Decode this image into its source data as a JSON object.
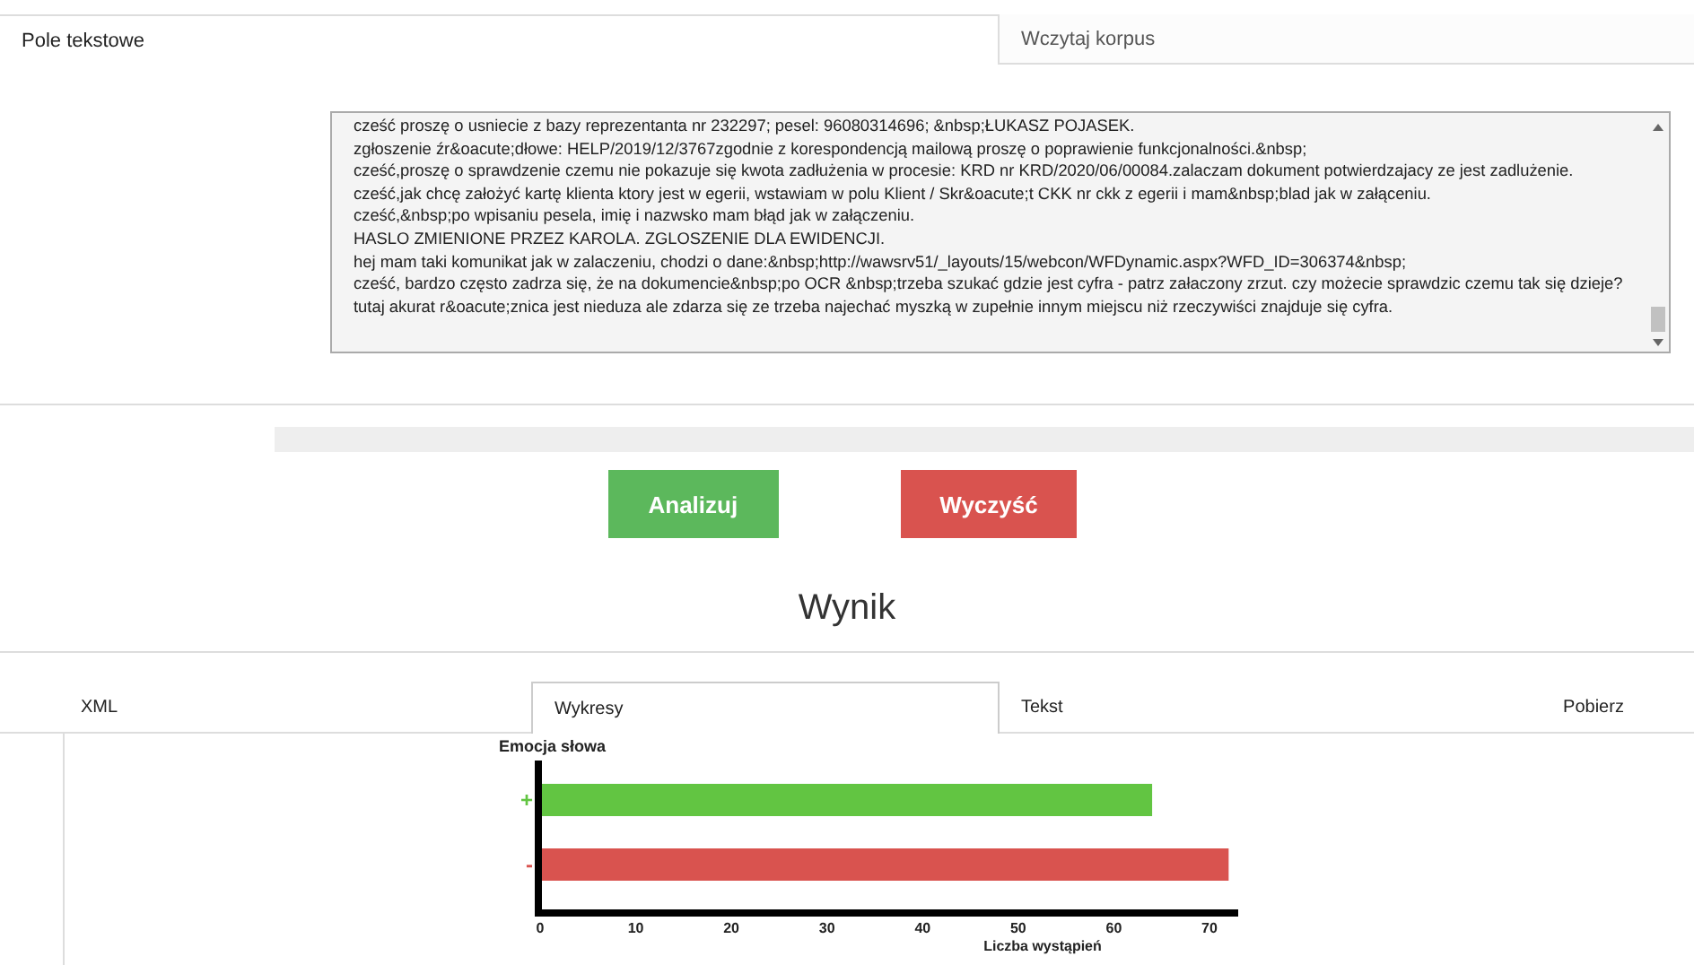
{
  "tabs": [
    {
      "label": "Pole tekstowe",
      "selected": true
    },
    {
      "label": "Wczytaj korpus",
      "selected": false
    }
  ],
  "textarea": {
    "lines": [
      "cześć proszę o usniecie z bazy reprezentanta nr 232297; pesel: 96080314696; &nbsp;ŁUKASZ POJASEK.",
      "zgłoszenie źr&oacute;dłowe: HELP/2019/12/3767zgodnie z korespondencją mailową proszę o poprawienie funkcjonalności.&nbsp;",
      "cześć,proszę o sprawdzenie czemu nie pokazuje się kwota zadłużenia w procesie: KRD nr KRD/2020/06/00084.zalaczam dokument potwierdzajacy ze jest zadlużenie.",
      "cześć,jak chcę założyć kartę klienta ktory jest w egerii, wstawiam w polu Klient / Skr&oacute;t CKK nr ckk z egerii i mam&nbsp;blad jak w załąceniu.",
      "cześć,&nbsp;po wpisaniu pesela, imię i nazwsko mam błąd jak w załączeniu.",
      "HASLO ZMIENIONE PRZEZ KAROLA. ZGLOSZENIE DLA EWIDENCJI.",
      "hej mam taki komunikat jak w zalaczeniu, chodzi o dane:&nbsp;http://wawsrv51/_layouts/15/webcon/WFDynamic.aspx?WFD_ID=306374&nbsp;",
      "cześć, bardzo często zadrza się, że na dokumencie&nbsp;po OCR &nbsp;trzeba szukać gdzie jest cyfra - patrz załaczony zrzut. czy możecie sprawdzic czemu tak się dzieje?",
      "tutaj akurat r&oacute;znica jest nieduza ale zdarza się ze trzeba najechać myszką w zupełnie innym miejscu niż rzeczywiści znajduje się cyfra."
    ]
  },
  "buttons": [
    {
      "label": "Analizuj",
      "kind": "primary"
    },
    {
      "label": "Wyczyść",
      "kind": "danger"
    }
  ],
  "result_title": "Wynik",
  "result_tabs": [
    {
      "label": "XML",
      "selected": false
    },
    {
      "label": "Wykresy",
      "selected": true
    },
    {
      "label": "Tekst",
      "selected": false
    },
    {
      "label": "Pobierz",
      "selected": false
    }
  ],
  "chart": {
    "chart_data": {
      "type": "bar",
      "orientation": "horizontal",
      "ylabel": "Emocja słowa",
      "xlabel": "Liczba wystąpień",
      "series": [
        {
          "name": "+",
          "color": "#62c542",
          "values": [
            64,
            null
          ]
        },
        {
          "name": "-",
          "color": "#d9534f",
          "values": [
            null,
            72
          ]
        }
      ],
      "xlim": [
        0,
        73
      ],
      "xticks": [
        0,
        10,
        20,
        30,
        40,
        50,
        60,
        70
      ]
    }
  }
}
